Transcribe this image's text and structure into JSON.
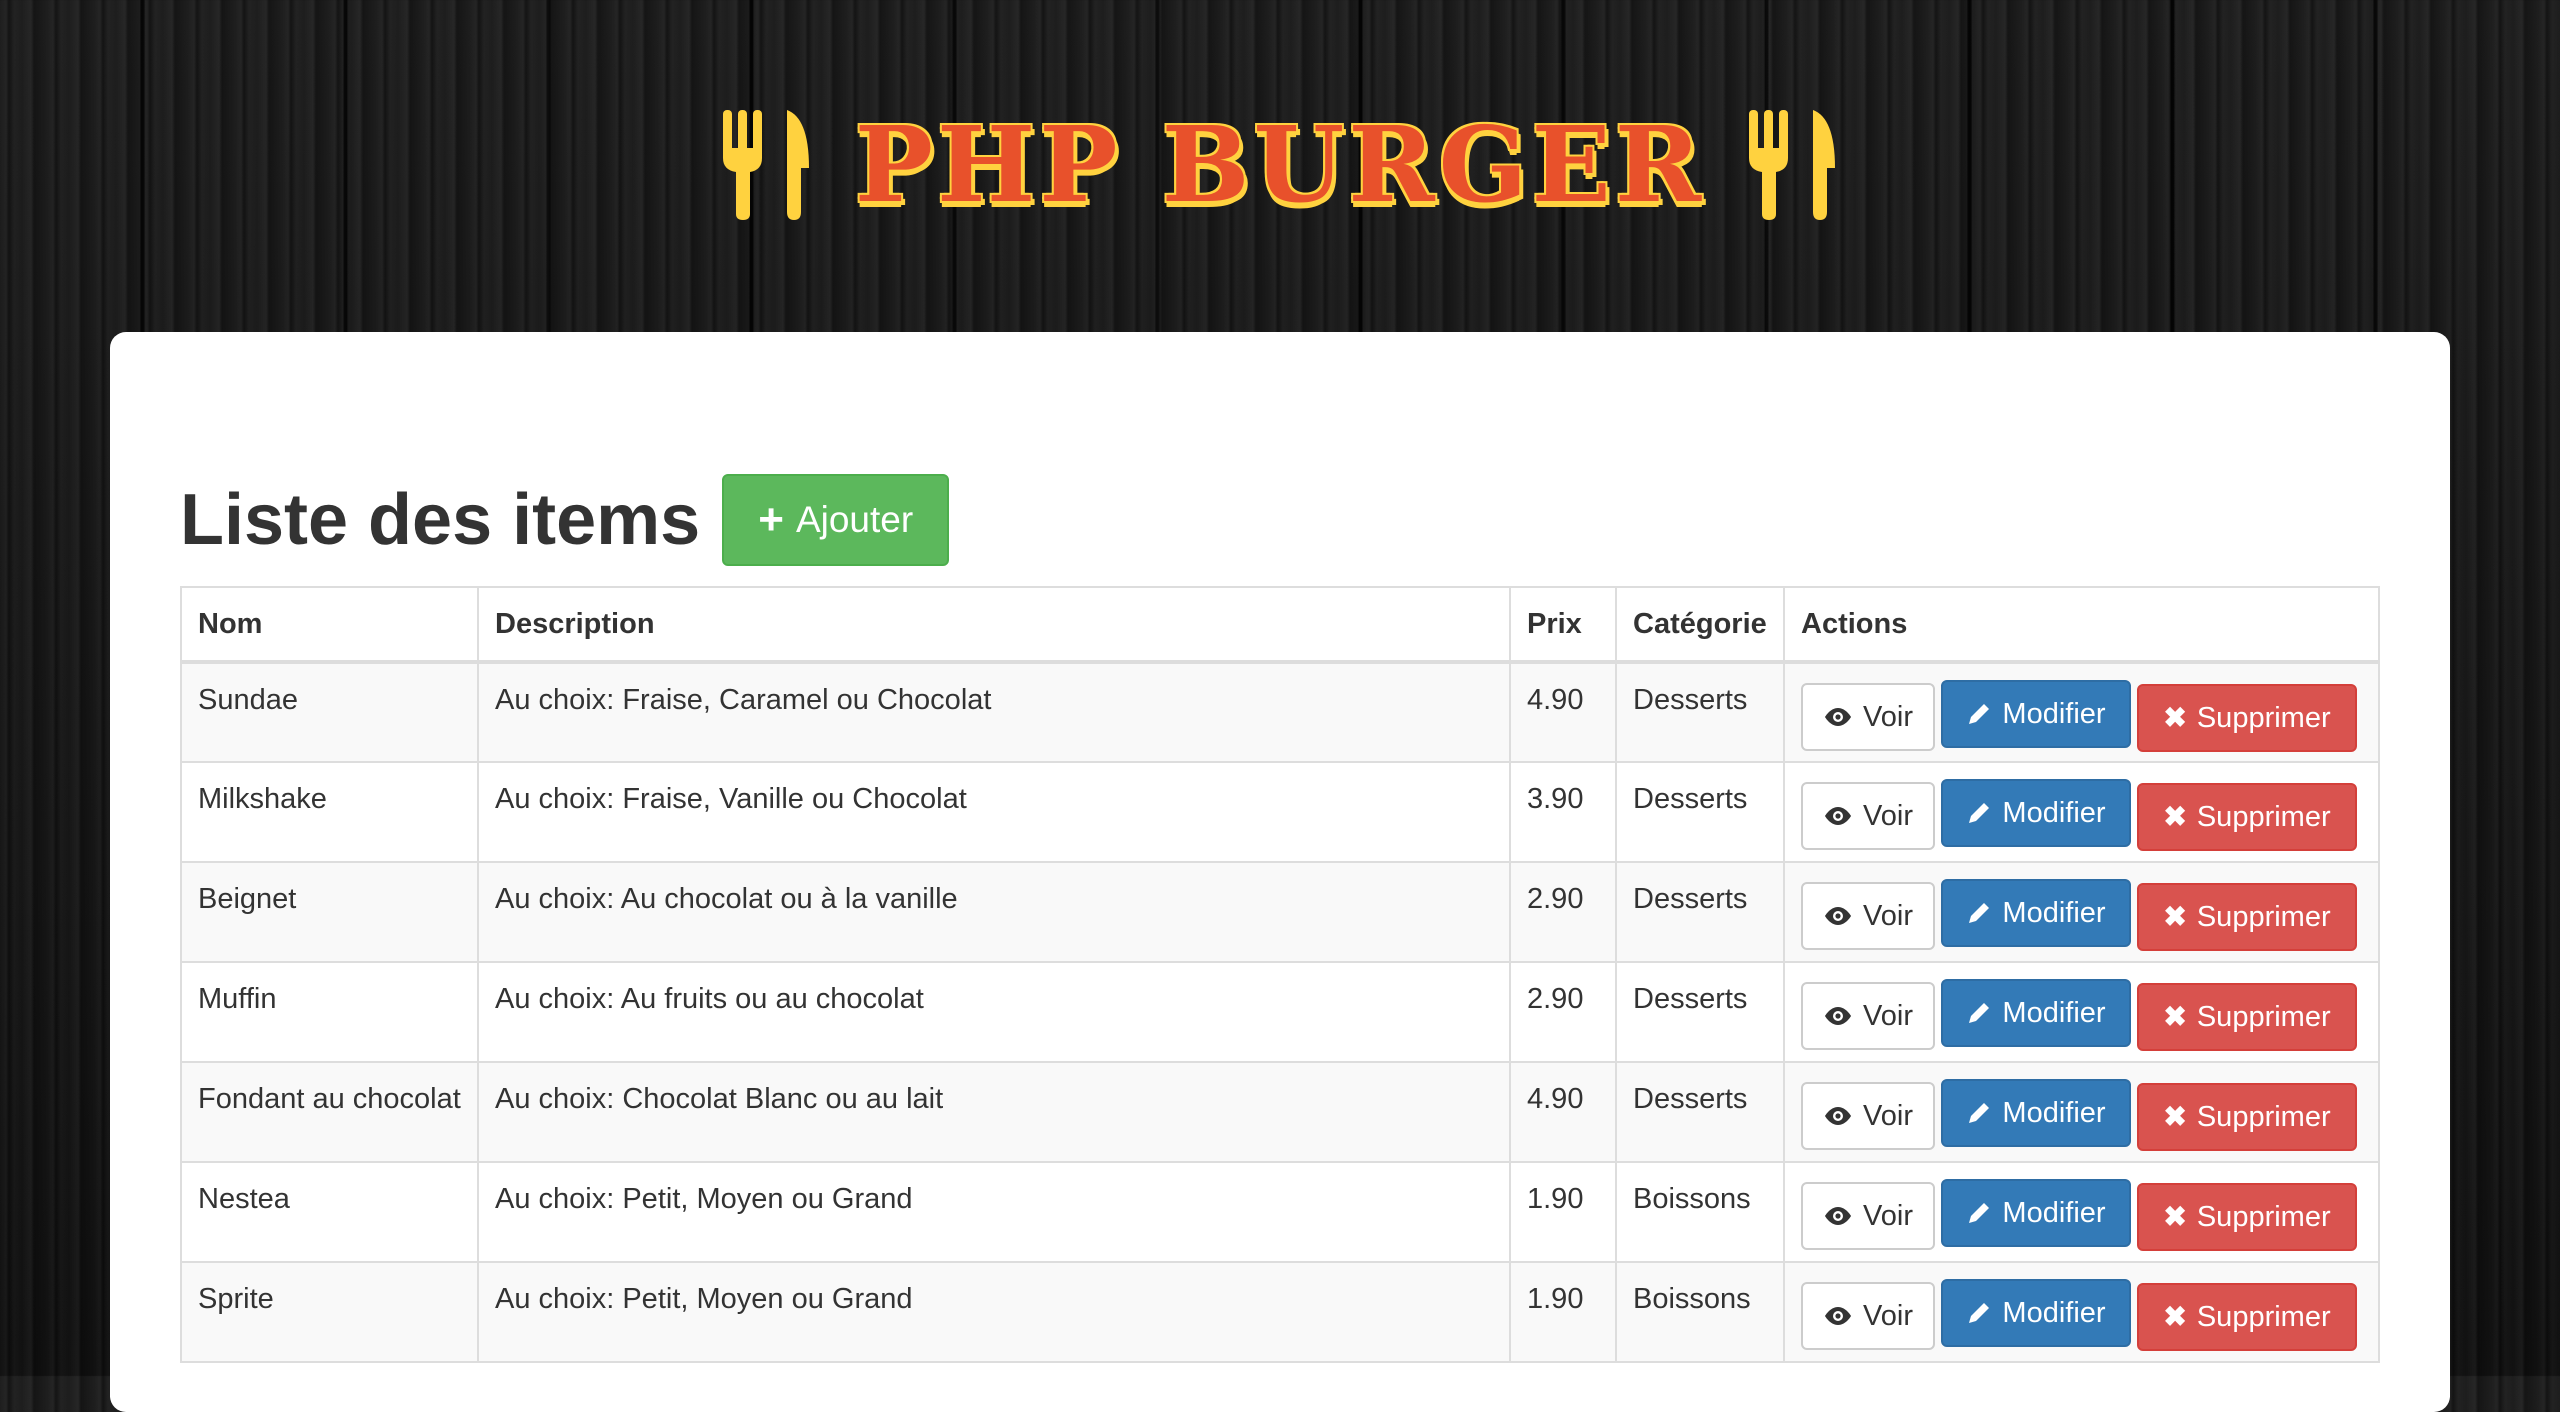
{
  "brand": {
    "title": "PHP BURGER",
    "color": "#e8512b",
    "accent": "#ffd23f",
    "icon": "fork-knife-icon"
  },
  "main": {
    "title": "Liste des items",
    "add_button": {
      "label": "Ajouter",
      "icon": "plus-icon",
      "color": "#5cb85c"
    }
  },
  "table": {
    "headers": {
      "name": "Nom",
      "description": "Description",
      "price": "Prix",
      "category": "Catégorie",
      "actions": "Actions"
    },
    "actions": {
      "view": {
        "label": "Voir",
        "icon": "eye-icon"
      },
      "edit": {
        "label": "Modifier",
        "icon": "pencil-icon",
        "color": "#337ab7"
      },
      "delete": {
        "label": "Supprimer",
        "icon": "close-icon",
        "color": "#d9534f"
      }
    },
    "rows": [
      {
        "name": "Sundae",
        "description": "Au choix: Fraise, Caramel ou Chocolat",
        "price": "4.90",
        "category": "Desserts"
      },
      {
        "name": "Milkshake",
        "description": "Au choix: Fraise, Vanille ou Chocolat",
        "price": "3.90",
        "category": "Desserts"
      },
      {
        "name": "Beignet",
        "description": "Au choix: Au chocolat ou à la vanille",
        "price": "2.90",
        "category": "Desserts"
      },
      {
        "name": "Muffin",
        "description": "Au choix: Au fruits ou au chocolat",
        "price": "2.90",
        "category": "Desserts"
      },
      {
        "name": "Fondant au chocolat",
        "description": "Au choix: Chocolat Blanc ou au lait",
        "price": "4.90",
        "category": "Desserts"
      },
      {
        "name": "Nestea",
        "description": "Au choix: Petit, Moyen ou Grand",
        "price": "1.90",
        "category": "Boissons"
      },
      {
        "name": "Sprite",
        "description": "Au choix: Petit, Moyen ou Grand",
        "price": "1.90",
        "category": "Boissons"
      }
    ]
  }
}
